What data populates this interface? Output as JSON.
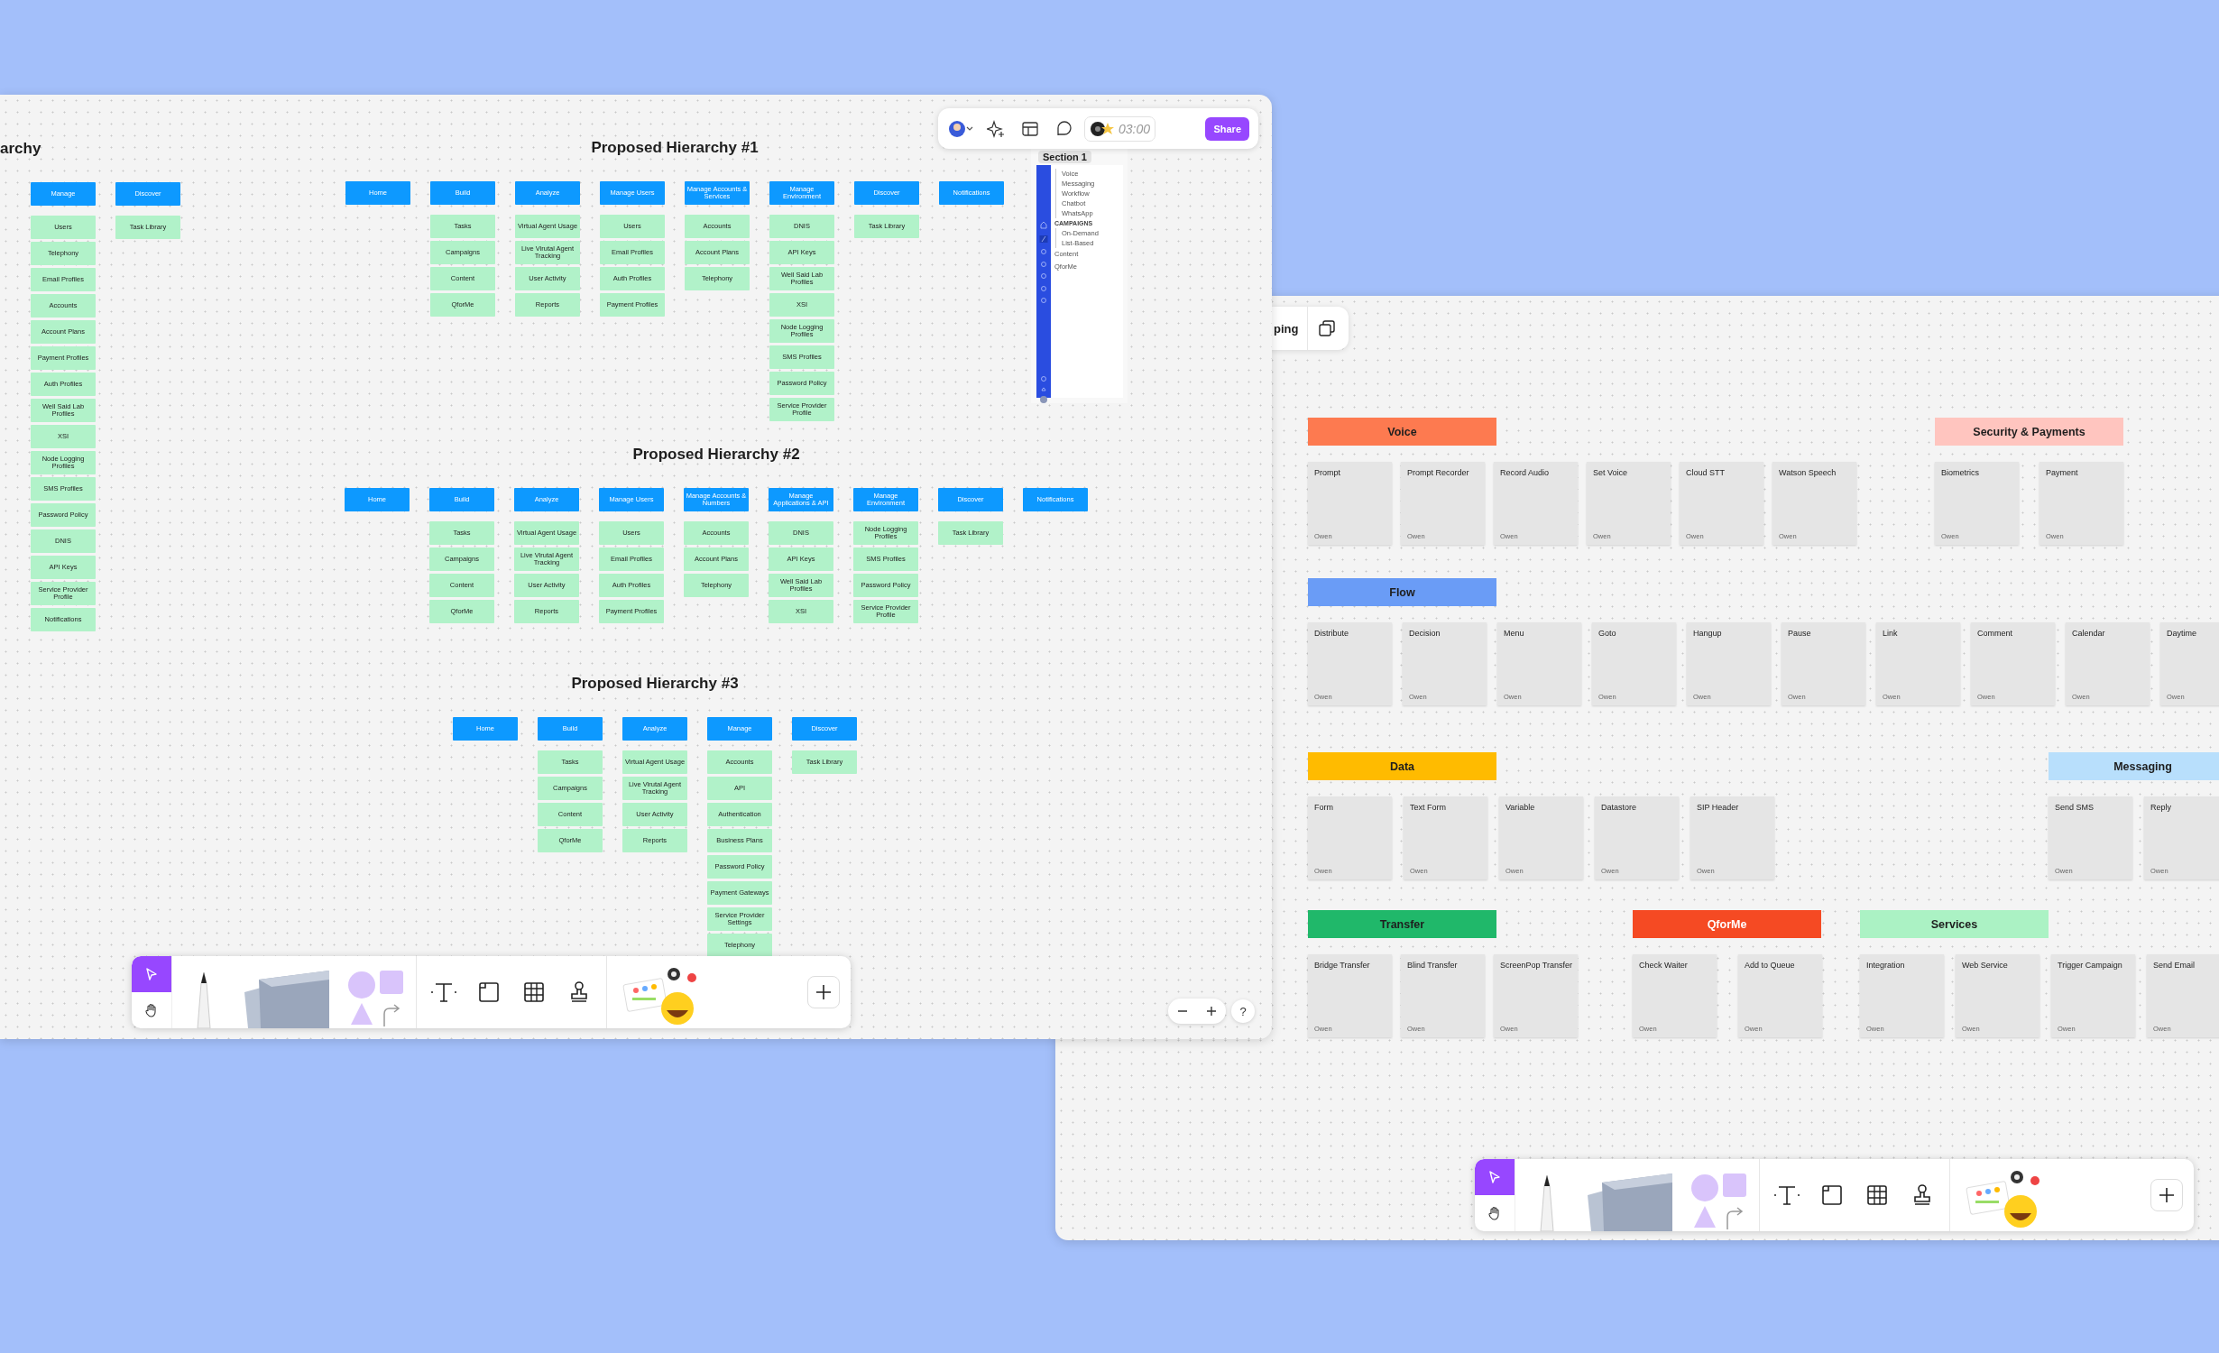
{
  "board": {
    "toolbar": {
      "timer": "03:00",
      "share": "Share"
    },
    "section": {
      "label": "Section 1",
      "nav": [
        {
          "label": "Voice",
          "kind": "child"
        },
        {
          "label": "Messaging",
          "kind": "child"
        },
        {
          "label": "Workflow",
          "kind": "child"
        },
        {
          "label": "Chatbot",
          "kind": "child"
        },
        {
          "label": "WhatsApp",
          "kind": "child"
        },
        {
          "label": "CAMPAIGNS",
          "kind": "heading"
        },
        {
          "label": "On-Demand",
          "kind": "child"
        },
        {
          "label": "List-Based",
          "kind": "child"
        },
        {
          "label": "Content",
          "kind": "item"
        },
        {
          "label": "QforMe",
          "kind": "item"
        }
      ]
    },
    "hierarchies": [
      {
        "title": "archy",
        "columns": [
          {
            "heading": "Manage",
            "items": [
              "Users",
              "Telephony",
              "Email Profiles",
              "Accounts",
              "Account Plans",
              "Payment Profiles",
              "Auth Profiles",
              "Well Said Lab Profiles",
              "XSI",
              "Node Logging Profiles",
              "SMS Profiles",
              "Password Policy",
              "DNIS",
              "API Keys",
              "Service Provider Profile",
              "Notifications"
            ]
          },
          {
            "heading": "Discover",
            "items": [
              "Task Library"
            ]
          }
        ]
      },
      {
        "title": "Proposed Hierarchy #1",
        "columns": [
          {
            "heading": "Home"
          },
          {
            "heading": "Build",
            "items": [
              "Tasks",
              "Campaigns",
              "Content",
              "QforMe"
            ]
          },
          {
            "heading": "Analyze",
            "items": [
              "Virtual Agent Usage",
              "Live Virutal Agent Tracking",
              "User Activity",
              "Reports"
            ]
          },
          {
            "heading": "Manage Users",
            "items": [
              "Users",
              "Email Profiles",
              "Auth Profiles",
              "Payment Profiles"
            ]
          },
          {
            "heading": "Manage Accounts & Services",
            "items": [
              "Accounts",
              "Account Plans",
              "Telephony"
            ]
          },
          {
            "heading": "Manage Environment",
            "items": [
              "DNIS",
              "API Keys",
              "Well Said Lab Profiles",
              "XSI",
              "Node Logging Profiles",
              "SMS Profiles",
              "Password Policy",
              "Service Provider Profile"
            ]
          },
          {
            "heading": "Discover",
            "items": [
              "Task Library"
            ]
          },
          {
            "heading": "Notifications"
          }
        ]
      },
      {
        "title": "Proposed Hierarchy #2",
        "columns": [
          {
            "heading": "Home"
          },
          {
            "heading": "Build",
            "items": [
              "Tasks",
              "Campaigns",
              "Content",
              "QforMe"
            ]
          },
          {
            "heading": "Analyze",
            "items": [
              "Virtual Agent Usage",
              "Live Virutal Agent Tracking",
              "User Activity",
              "Reports"
            ]
          },
          {
            "heading": "Manage Users",
            "items": [
              "Users",
              "Email Profiles",
              "Auth Profiles",
              "Payment Profiles"
            ]
          },
          {
            "heading": "Manage Accounts & Numbers",
            "items": [
              "Accounts",
              "Account Plans",
              "Telephony"
            ]
          },
          {
            "heading": "Manage Applications & API",
            "items": [
              "DNIS",
              "API Keys",
              "Well Said Lab Profiles",
              "XSI"
            ]
          },
          {
            "heading": "Manage Environment",
            "items": [
              "Node Logging Profiles",
              "SMS Profiles",
              "Password Policy",
              "Service Provider Profile"
            ]
          },
          {
            "heading": "Discover",
            "items": [
              "Task Library"
            ]
          },
          {
            "heading": "Notifications"
          }
        ]
      },
      {
        "title": "Proposed Hierarchy #3",
        "columns": [
          {
            "heading": "Home"
          },
          {
            "heading": "Build",
            "items": [
              "Tasks",
              "Campaigns",
              "Content",
              "QforMe"
            ]
          },
          {
            "heading": "Analyze",
            "items": [
              "Virtual Agent Usage",
              "Live Virutal Agent Tracking",
              "User Activity",
              "Reports"
            ]
          },
          {
            "heading": "Manage",
            "items": [
              "Accounts",
              "API",
              "Authentication",
              "Business Plans",
              "Password Policy",
              "Payment Gateways",
              "Service Provider Settings",
              "Telephony"
            ]
          },
          {
            "heading": "Discover",
            "items": [
              "Task Library"
            ]
          }
        ]
      }
    ],
    "zoom": {
      "help": "?"
    }
  },
  "mapping": {
    "toolbar_text": "ping",
    "categories": [
      {
        "title": "Voice",
        "color": "#fd7a50",
        "cards": [
          {
            "title": "Prompt",
            "author": "Owen"
          },
          {
            "title": "Prompt Recorder",
            "author": "Owen"
          },
          {
            "title": "Record Audio",
            "author": "Owen"
          },
          {
            "title": "Set Voice",
            "author": "Owen"
          },
          {
            "title": "Cloud STT",
            "author": "Owen"
          },
          {
            "title": "Watson Speech",
            "author": "Owen"
          }
        ]
      },
      {
        "title": "Security & Payments",
        "color": "#ffc5bf",
        "cards": [
          {
            "title": "Biometrics",
            "author": "Owen"
          },
          {
            "title": "Payment",
            "author": "Owen"
          }
        ]
      },
      {
        "title": "Flow",
        "color": "#6a9cf6",
        "cards": [
          {
            "title": "Distribute",
            "author": "Owen"
          },
          {
            "title": "Decision",
            "author": "Owen"
          },
          {
            "title": "Menu",
            "author": "Owen"
          },
          {
            "title": "Goto",
            "author": "Owen"
          },
          {
            "title": "Hangup",
            "author": "Owen"
          },
          {
            "title": "Pause",
            "author": "Owen"
          },
          {
            "title": "Link",
            "author": "Owen"
          },
          {
            "title": "Comment",
            "author": "Owen"
          },
          {
            "title": "Calendar",
            "author": "Owen"
          },
          {
            "title": "Daytime",
            "author": "Owen"
          }
        ]
      },
      {
        "title": "Data",
        "color": "#ffbb00",
        "cards": [
          {
            "title": "Form",
            "author": "Owen"
          },
          {
            "title": "Text Form",
            "author": "Owen"
          },
          {
            "title": "Variable",
            "author": "Owen"
          },
          {
            "title": "Datastore",
            "author": "Owen"
          },
          {
            "title": "SIP Header",
            "author": "Owen"
          }
        ]
      },
      {
        "title": "Messaging",
        "color": "#b8dffc",
        "cards": [
          {
            "title": "Send SMS",
            "author": "Owen"
          },
          {
            "title": "Reply",
            "author": "Owen"
          }
        ]
      },
      {
        "title": "Transfer",
        "color": "#20b86a",
        "cards": [
          {
            "title": "Bridge Transfer",
            "author": "Owen"
          },
          {
            "title": "Blind Transfer",
            "author": "Owen"
          },
          {
            "title": "ScreenPop Transfer",
            "author": "Owen"
          }
        ]
      },
      {
        "title": "QforMe",
        "color": "#f54a23",
        "cards": [
          {
            "title": "Check Waiter",
            "author": "Owen"
          },
          {
            "title": "Add to Queue",
            "author": "Owen"
          }
        ]
      },
      {
        "title": "Services",
        "color": "#abf2c4",
        "cards": [
          {
            "title": "Integration",
            "author": "Owen"
          },
          {
            "title": "Web Service",
            "author": "Owen"
          },
          {
            "title": "Trigger Campaign",
            "author": "Owen"
          },
          {
            "title": "Send Email",
            "author": "Owen"
          }
        ]
      }
    ]
  }
}
